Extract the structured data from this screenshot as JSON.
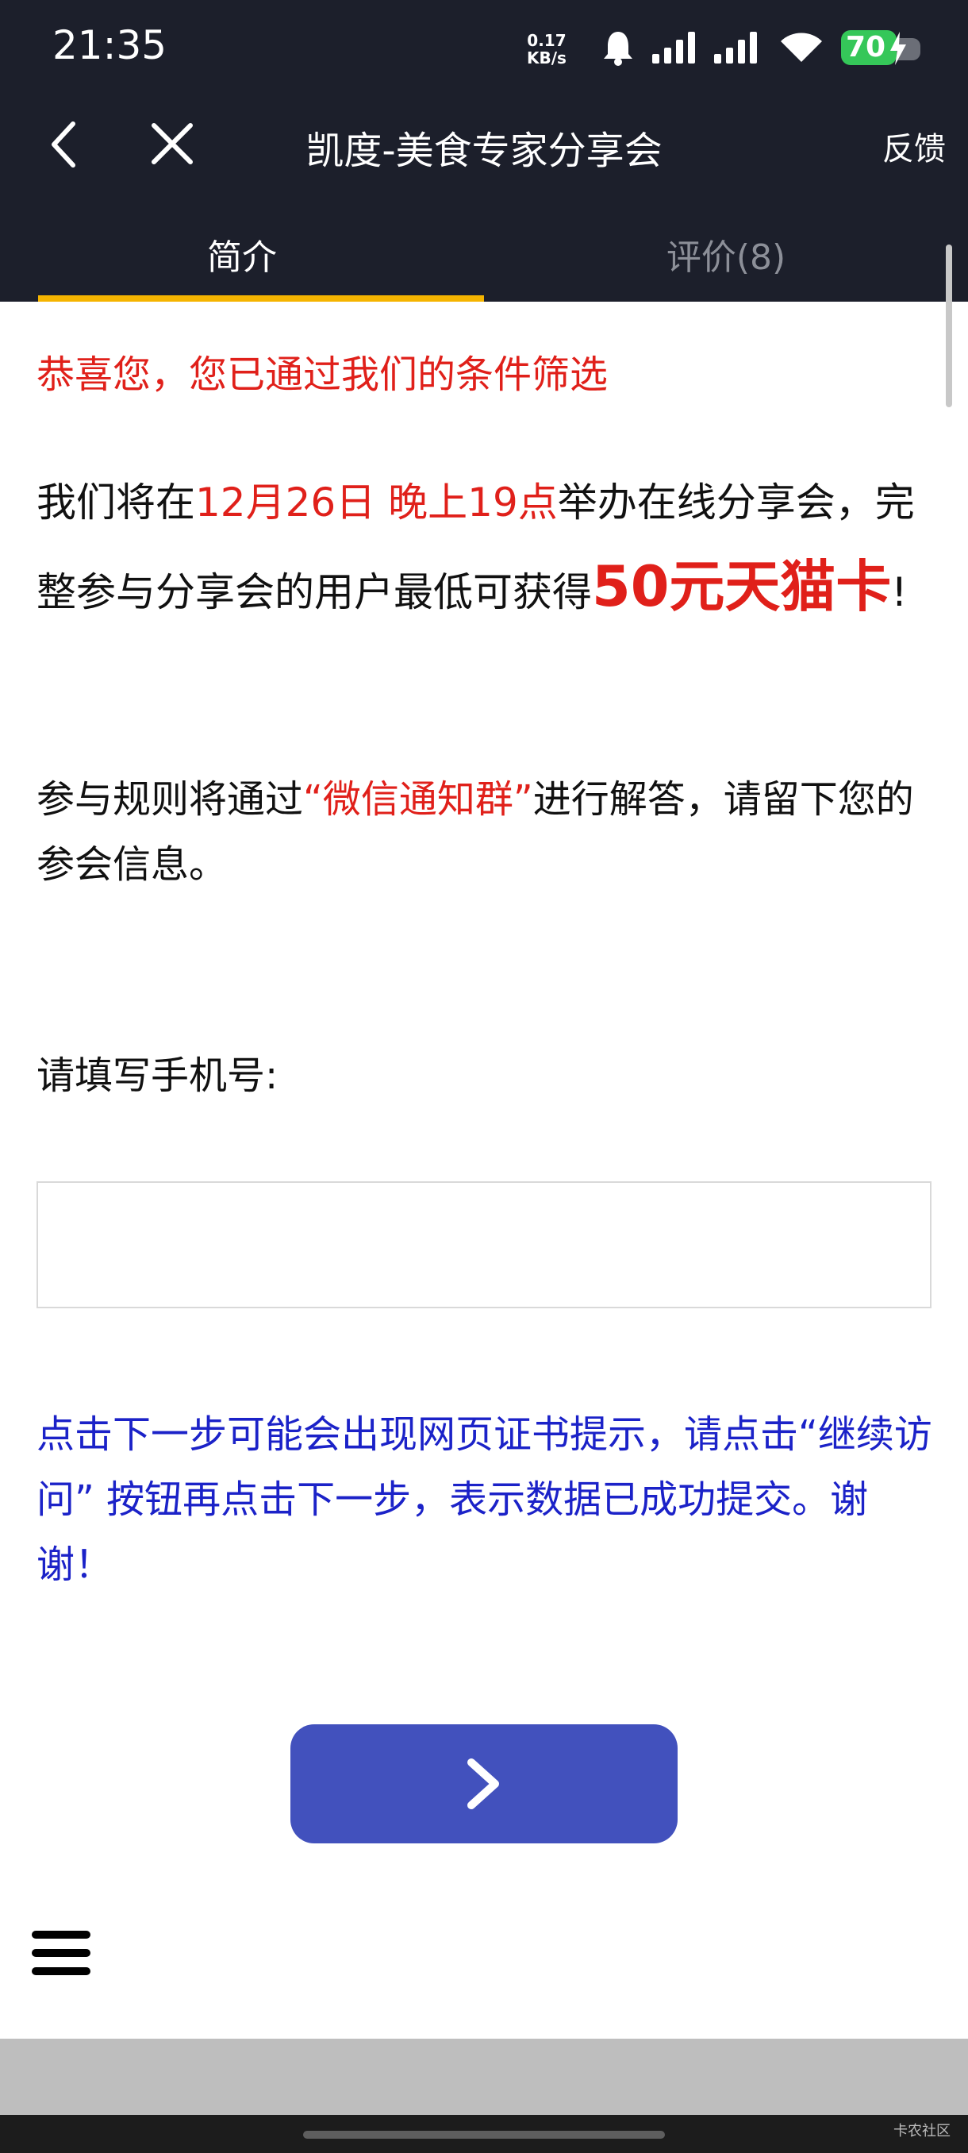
{
  "status_bar": {
    "time": "21:35",
    "net_speed_value": "0.17",
    "net_speed_unit": "KB/s",
    "battery": "70"
  },
  "header": {
    "title": "凯度-美食专家分享会",
    "feedback": "反馈"
  },
  "tabs": [
    {
      "label": "简介",
      "active": true
    },
    {
      "label": "评价(8)",
      "active": false
    }
  ],
  "content": {
    "congrats": "恭喜您，您已通过我们的条件筛选",
    "para1_a": "我们将在",
    "para1_date": "12月26日 晚上19点",
    "para1_b": "举办在线分享会，完整参与分享会的用户最低可获得",
    "para1_prize": "50元天猫卡",
    "para1_c": "!",
    "para2_a": "参与规则将通过",
    "para2_highlight": "“微信通知群”",
    "para2_b": "进行解答，请留下您的参会信息。",
    "phone_label": "请填写手机号:",
    "phone_value": "",
    "notice": "点击下一步可能会出现网页证书提示，请点击“继续访问” 按钮再点击下一步，表示数据已成功提交。谢谢！"
  },
  "watermark": "卡农社区",
  "colors": {
    "dark_bg": "#1c1f2b",
    "tab_accent": "#f5b400",
    "red": "#e0201a",
    "notice_blue": "#1b22c8",
    "button_blue": "#4251bd"
  }
}
